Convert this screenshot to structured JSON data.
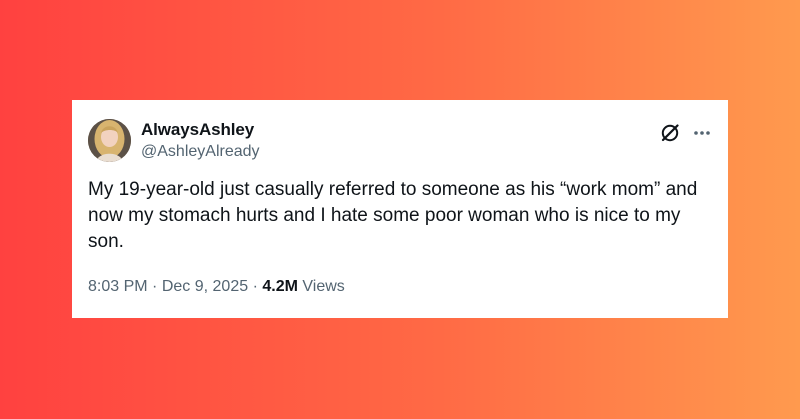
{
  "tweet": {
    "author": {
      "display_name": "AlwaysAshley",
      "handle": "@AshleyAlready",
      "avatar_icon": "profile-photo"
    },
    "text": "My 19-year-old just casually referred to someone as his “work mom” and now my stomach hurts and I hate some poor woman who is nice to my son.",
    "time": "8:03 PM",
    "separator": "·",
    "date": "Dec 9, 2025",
    "views_count": "4.2M",
    "views_label": "Views",
    "icons": [
      "grok-icon",
      "more-icon"
    ]
  },
  "colors": {
    "background_start": "#ff4140",
    "background_end": "#ff9a4e",
    "card": "#ffffff",
    "text_primary": "#0f1419",
    "text_secondary": "#536471"
  }
}
